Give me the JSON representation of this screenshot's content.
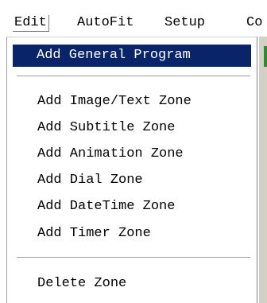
{
  "menubar": {
    "items": [
      {
        "label": "Edit",
        "active": true
      },
      {
        "label": "AutoFit"
      },
      {
        "label": "Setup"
      },
      {
        "label": "Co"
      }
    ]
  },
  "edit_menu": {
    "items": [
      {
        "label": "Add General Program",
        "highlighted": true
      },
      {
        "label": "Add Image/Text Zone"
      },
      {
        "label": "Add Subtitle Zone"
      },
      {
        "label": "Add Animation Zone"
      },
      {
        "label": "Add Dial Zone"
      },
      {
        "label": "Add DateTime Zone"
      },
      {
        "label": "Add Timer Zone"
      },
      {
        "label": "Delete Zone"
      }
    ]
  },
  "colors": {
    "highlight_bg": "#0a246a",
    "highlight_text": "#ffffff",
    "separator": "#9c9c9c"
  }
}
